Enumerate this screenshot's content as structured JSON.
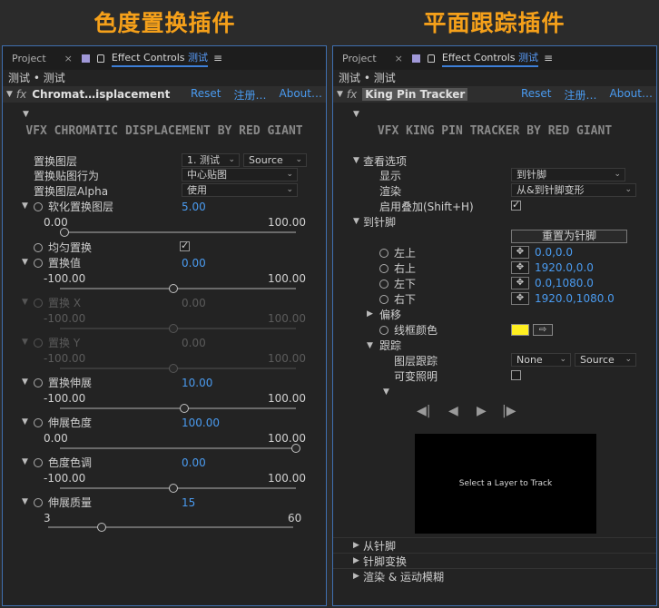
{
  "banners": {
    "left": "色度置换插件",
    "right": "平面跟踪插件"
  },
  "left_panel": {
    "tab_project": "Project",
    "tab_close": "×",
    "tab_effect": "Effect Controls",
    "tab_layer": "测试",
    "menu": "≡",
    "comp_title": "测试 • 测试",
    "fx_name": "Chromat…isplacement",
    "reset": "Reset",
    "register": "注册…",
    "about": "About…",
    "header": "VFX CHROMATIC DISPLACEMENT BY RED GIANT",
    "disp_layer_label": "置换图层",
    "disp_layer_value": "1. 测试",
    "disp_layer_source": "Source",
    "disp_map_label": "置换贴图行为",
    "disp_map_value": "中心贴图",
    "disp_alpha_label": "置换图层Alpha",
    "disp_alpha_value": "使用",
    "soften_label": "软化置换图层",
    "soften_value": "5.00",
    "soften_min": "0.00",
    "soften_max": "100.00",
    "even_label": "均匀置换",
    "amount_label": "置换值",
    "amount_value": "0.00",
    "amount_min": "-100.00",
    "amount_max": "100.00",
    "dx_label": "置换 X",
    "dx_value": "0.00",
    "dx_min": "-100.00",
    "dx_max": "100.00",
    "dy_label": "置换 Y",
    "dy_value": "0.00",
    "dy_min": "-100.00",
    "dy_max": "100.00",
    "stretch_label": "置换伸展",
    "stretch_value": "10.00",
    "stretch_min": "-100.00",
    "stretch_max": "100.00",
    "spread_label": "伸展色度",
    "spread_value": "100.00",
    "spread_min": "0.00",
    "spread_max": "100.00",
    "hue_label": "色度色调",
    "hue_value": "0.00",
    "hue_min": "-100.00",
    "hue_max": "100.00",
    "quality_label": "伸展质量",
    "quality_value": "15",
    "quality_min": "3",
    "quality_max": "60"
  },
  "right_panel": {
    "tab_project": "Project",
    "tab_close": "×",
    "tab_effect": "Effect Controls",
    "tab_layer": "测试",
    "menu": "≡",
    "comp_title": "测试 • 测试",
    "fx_name": "King Pin Tracker",
    "reset": "Reset",
    "register": "注册…",
    "about": "About…",
    "header": "VFX KING PIN TRACKER BY RED GIANT",
    "view_options": "查看选项",
    "display_label": "显示",
    "display_value": "到针脚",
    "render_label": "渲染",
    "render_value": "从&到针脚变形",
    "overlay_label": "启用叠加(Shift+H)",
    "to_pin": "到针脚",
    "reset_pin_button": "重置为针脚",
    "tl_label": "左上",
    "tl_value": "0.0,0.0",
    "tr_label": "右上",
    "tr_value": "1920.0,0.0",
    "bl_label": "左下",
    "bl_value": "0.0,1080.0",
    "br_label": "右下",
    "br_value": "1920.0,1080.0",
    "offset": "偏移",
    "frame_color": "线框颜色",
    "track": "跟踪",
    "layer_track_label": "图层跟踪",
    "layer_track_value": "None",
    "layer_track_source": "Source",
    "variable_light": "可变照明",
    "preview_text": "Select a Layer to Track",
    "from_pin": "从针脚",
    "pin_transform": "针脚变换",
    "render_motion_blur": "渲染 & 运动模糊"
  },
  "colors": {
    "accent_blue": "#4a9bf0",
    "banner_orange": "#f5a01a",
    "frame_color": "#ffef20"
  }
}
